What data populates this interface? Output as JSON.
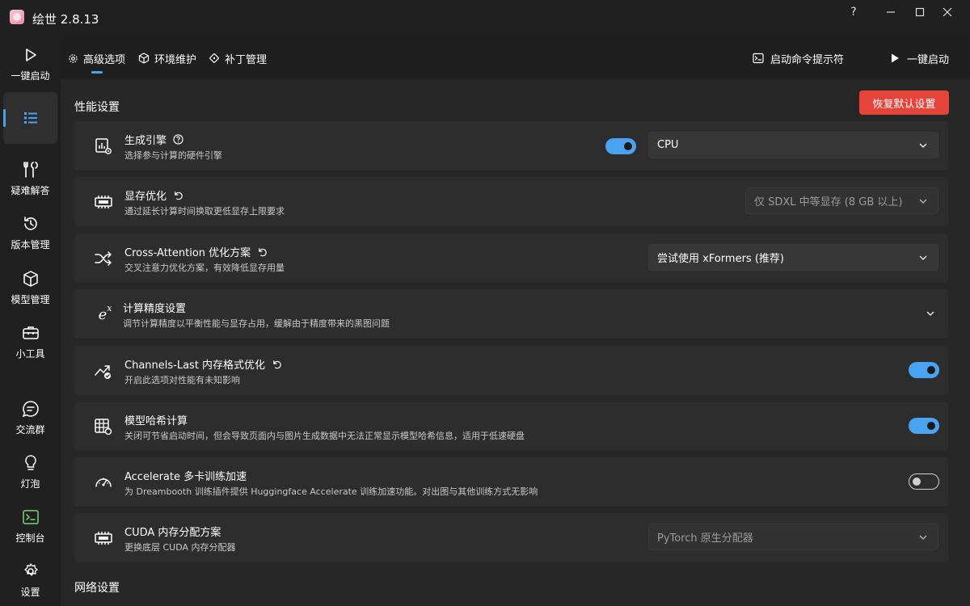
{
  "window": {
    "title": "绘世 2.8.13",
    "help_glyph": "?",
    "minimize_glyph": "—",
    "maximize_glyph": "☐",
    "close_glyph": "✕"
  },
  "sidebar": {
    "items": [
      {
        "label": "一键启动",
        "icon": "play-icon"
      },
      {
        "label": "",
        "icon": "list-icon",
        "active": true
      },
      {
        "label": "疑难解答",
        "icon": "wrench-icon"
      },
      {
        "label": "版本管理",
        "icon": "history-icon"
      },
      {
        "label": "模型管理",
        "icon": "cube-icon"
      },
      {
        "label": "小工具",
        "icon": "toolbox-icon"
      },
      {
        "label": "交流群",
        "icon": "chat-icon"
      },
      {
        "label": "灯泡",
        "icon": "bulb-icon"
      },
      {
        "label": "控制台",
        "icon": "console-icon"
      },
      {
        "label": "设置",
        "icon": "settings-icon"
      }
    ]
  },
  "topnav": {
    "tabs": [
      {
        "label": "高级选项",
        "icon": "gear-tab-icon"
      },
      {
        "label": "环境维护",
        "icon": "box-tab-icon"
      },
      {
        "label": "补丁管理",
        "icon": "patch-tab-icon"
      }
    ],
    "console_button": "启动命令提示符",
    "launch_button": "一键启动"
  },
  "performance": {
    "section_title": "性能设置",
    "reset_button": "恢复默认设置",
    "items": [
      {
        "title": "生成引擎",
        "desc": "选择参与计算的硬件引擎",
        "toggle": true,
        "dropdown": "CPU",
        "icon": "engine-icon",
        "extra_icon": "help-circle-icon"
      },
      {
        "title": "显存优化",
        "desc": "通过延长计算时间换取更低显存上限要求",
        "dropdown": "仅 SDXL 中等显存 (8 GB 以上)",
        "dropdown_disabled": true,
        "icon": "memory-icon",
        "extra_icon": "undo-icon"
      },
      {
        "title": "Cross-Attention 优化方案",
        "desc": "交叉注意力优化方案，有效降低显存用量",
        "dropdown": "尝试使用 xFormers (推荐)",
        "icon": "shuffle-icon",
        "extra_icon": "undo-icon"
      },
      {
        "title": "计算精度设置",
        "desc": "调节计算精度以平衡性能与显存占用，缓解由于精度带来的黑图问题",
        "expandable": true,
        "icon": "exponent-icon",
        "icon_text": "e",
        "icon_sup": "x"
      },
      {
        "title": "Channels-Last 内存格式优化",
        "desc": "开启此选项对性能有未知影响",
        "toggle": true,
        "icon": "trend-icon",
        "extra_icon": "undo-icon"
      },
      {
        "title": "模型哈希计算",
        "desc": "关闭可节省启动时间，但会导致页面内与图片生成数据中无法正常显示模型哈希信息，适用于低速硬盘",
        "toggle": true,
        "icon": "table-icon"
      },
      {
        "title": "Accelerate 多卡训练加速",
        "desc": "为 Dreambooth 训练插件提供 Huggingface Accelerate 训练加速功能。对出图与其他训练方式无影响",
        "toggle": false,
        "icon": "gauge-icon"
      },
      {
        "title": "CUDA 内存分配方案",
        "desc": "更换底层 CUDA 内存分配器",
        "dropdown": "PyTorch 原生分配器",
        "dropdown_disabled": true,
        "icon": "memory-icon"
      }
    ]
  },
  "network": {
    "section_title": "网络设置"
  },
  "colors": {
    "accent": "#4aa3f0",
    "danger": "#e5443a",
    "background": "#202020",
    "panel": "#272727",
    "card": "#2d2d2d",
    "console_green": "#7ed47e"
  }
}
